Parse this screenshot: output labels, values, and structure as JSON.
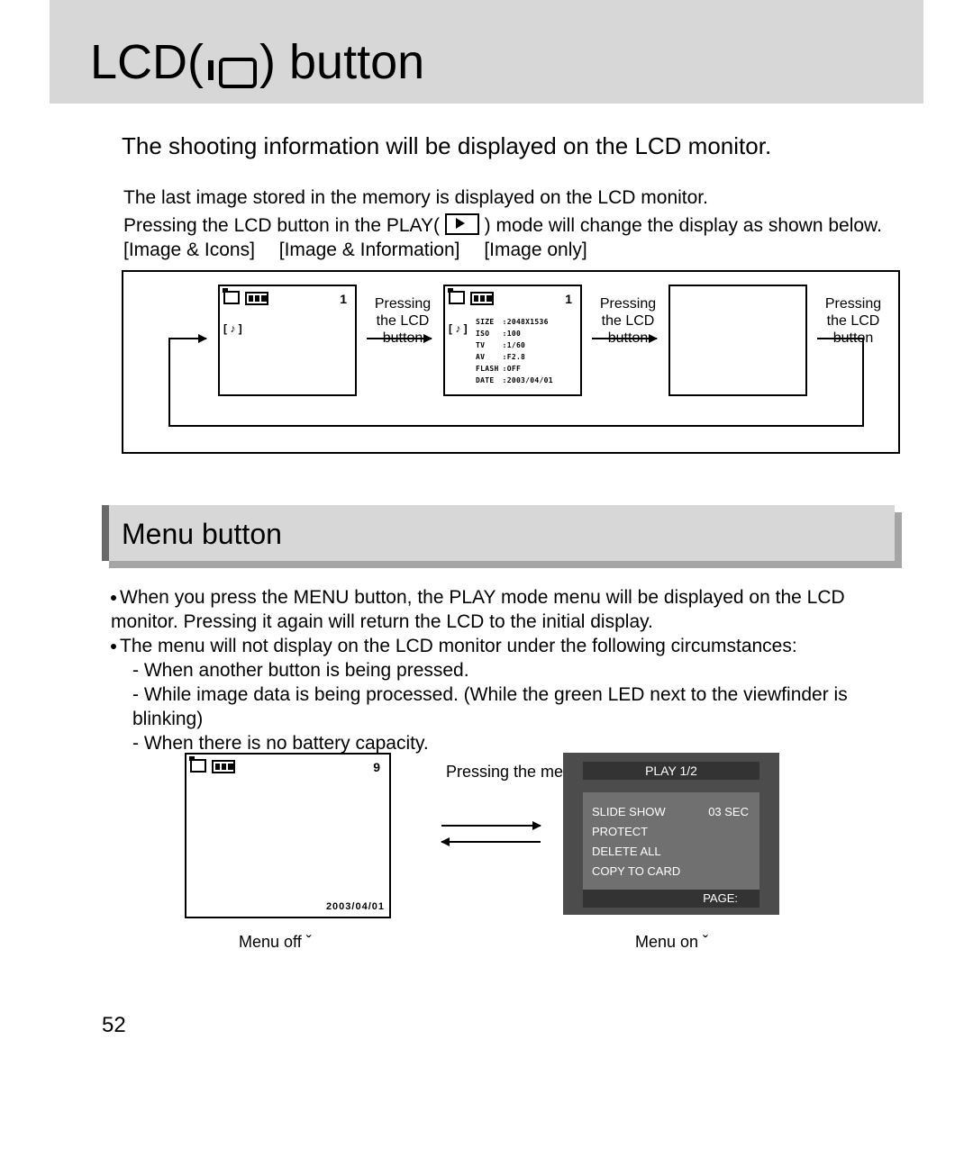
{
  "title_prefix": "LCD(",
  "title_suffix": ") button",
  "subtitle": "The shooting information will be displayed on the LCD monitor.",
  "body1_l1": "The last image stored in the memory is displayed on the LCD monitor.",
  "body1_l2a": "Pressing the LCD button in the PLAY( ",
  "body1_l2b": " ) mode will change the display as shown below.",
  "body1_l3": "[Image & Icons]  [Image & Information]  [Image only]",
  "scr_number": "1",
  "music_glyph": "[ ♪ ]",
  "pressing_lcd": "Pressing the LCD button",
  "exif": {
    "size_k": "SIZE",
    "size_v": ":2048X1536",
    "iso_k": "ISO",
    "iso_v": ":100",
    "tv_k": "TV",
    "tv_v": ":1/60",
    "av_k": "AV",
    "av_v": ":F2.8",
    "flash_k": "FLASH",
    "flash_v": ":OFF",
    "date_k": "DATE",
    "date_v": ":2003/04/01"
  },
  "menu_button_title": "Menu button",
  "mb_p1": "When you press the MENU button, the PLAY mode menu will be displayed on the LCD monitor. Pressing it again will return the LCD to the initial display.",
  "mb_p2": "The menu will not display on the LCD monitor under the following circumstances:",
  "mb_p2a": "- When another button is being pressed.",
  "mb_p2b": "- While image data is being processed. (While the green LED next to the viewfinder is blinking)",
  "mb_p2c": "- When there is no battery capacity.",
  "menu_scr_number": "9",
  "menu_date": "2003/04/01",
  "pressing_menu": "Pressing the menu button",
  "menu_off_caption": "Menu off ˇ",
  "menu_on_caption": "Menu on ˇ",
  "menu_on": {
    "head": "PLAY 1/2",
    "i1": "SLIDE SHOW",
    "i1v": "03 SEC",
    "i2": "PROTECT",
    "i3": "DELETE ALL",
    "i4": "COPY TO CARD",
    "foot": "PAGE:"
  },
  "page_number": "52"
}
